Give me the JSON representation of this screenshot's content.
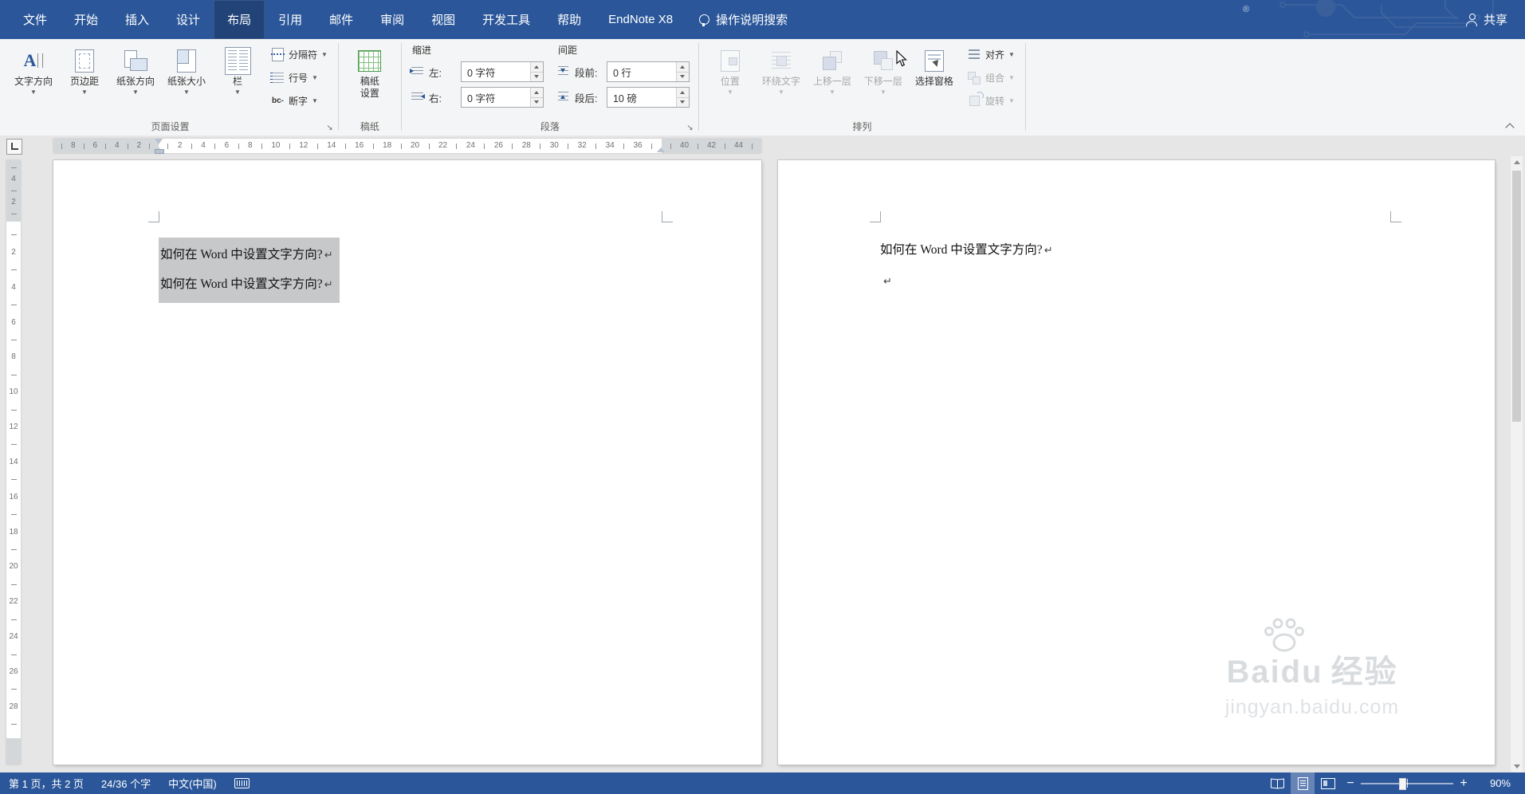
{
  "titlebar": {
    "tabs": [
      {
        "label": "文件"
      },
      {
        "label": "开始"
      },
      {
        "label": "插入"
      },
      {
        "label": "设计"
      },
      {
        "label": "布局",
        "active": true
      },
      {
        "label": "引用"
      },
      {
        "label": "邮件"
      },
      {
        "label": "审阅"
      },
      {
        "label": "视图"
      },
      {
        "label": "开发工具"
      },
      {
        "label": "帮助"
      },
      {
        "label": "EndNote X8"
      }
    ],
    "tell_me": "操作说明搜索",
    "share": "共享"
  },
  "ribbon": {
    "page_setup": {
      "label": "页面设置",
      "text_direction": "文字方向",
      "margins": "页边距",
      "orientation": "纸张方向",
      "paper_size": "纸张大小",
      "columns": "栏",
      "breaks": "分隔符",
      "line_numbers": "行号",
      "hyphenation": "断字",
      "hyphenation_icon": "bc"
    },
    "manuscript": {
      "label": "稿纸",
      "setup": "稿纸设置"
    },
    "paragraph": {
      "label": "段落",
      "indent_label": "缩进",
      "indent_left_label": "左:",
      "indent_left_value": "0 字符",
      "indent_right_label": "右:",
      "indent_right_value": "0 字符",
      "spacing_label": "间距",
      "space_before_label": "段前:",
      "space_before_value": "0 行",
      "space_after_label": "段后:",
      "space_after_value": "10 磅"
    },
    "arrange": {
      "label": "排列",
      "position": "位置",
      "wrap_text": "环绕文字",
      "bring_forward": "上移一层",
      "send_backward": "下移一层",
      "selection_pane": "选择窗格",
      "align": "对齐",
      "group": "组合",
      "rotate": "旋转"
    }
  },
  "ruler": {
    "h_margin_left": [
      "8",
      "6",
      "4",
      "2"
    ],
    "h_text_area": [
      "2",
      "4",
      "6",
      "8",
      "10",
      "12",
      "14",
      "16",
      "18",
      "20",
      "22",
      "24",
      "26",
      "28",
      "30",
      "32",
      "34",
      "36"
    ],
    "h_margin_right": [
      "40",
      "42",
      "44"
    ],
    "v_top": [
      "4",
      "2"
    ],
    "v_page": [
      "2",
      "4",
      "6",
      "8",
      "10",
      "12",
      "14",
      "16",
      "18",
      "20",
      "22",
      "24",
      "26",
      "28"
    ]
  },
  "document": {
    "left_page": {
      "line1": "如何在 Word 中设置文字方向?",
      "line2": "如何在 Word 中设置文字方向?",
      "return_mark": "↵"
    },
    "right_page": {
      "line1": "如何在 Word 中设置文字方向?",
      "return_mark": "↵",
      "watermark_brand": "Baidu",
      "watermark_suffix": "经验",
      "watermark_domain": "jingyan.baidu.com"
    }
  },
  "statusbar": {
    "page_info": "第 1 页，共 2 页",
    "word_count": "24/36 个字",
    "language": "中文(中国)",
    "zoom_level": "90%"
  },
  "colors": {
    "accent_blue": "#2b579a",
    "selection_gray": "#c6c8ca",
    "page_white": "#ffffff",
    "canvas_gray": "#e6e6e6"
  }
}
